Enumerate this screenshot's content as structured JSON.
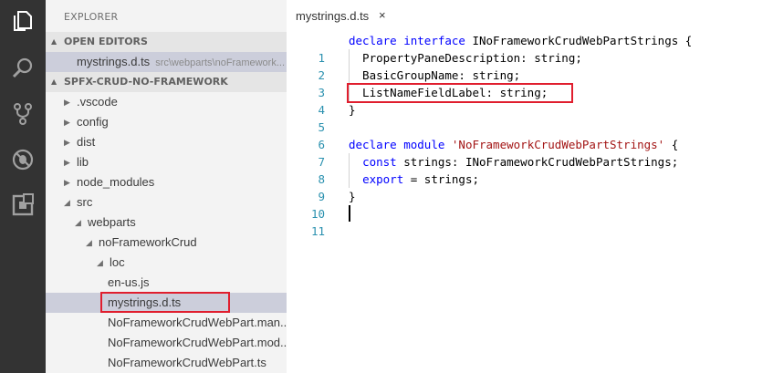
{
  "activity_bar": {
    "icons": [
      "files-icon",
      "search-icon",
      "source-control-icon",
      "debug-icon",
      "extensions-icon"
    ]
  },
  "sidebar": {
    "title": "EXPLORER",
    "open_editors": {
      "header": "OPEN EDITORS",
      "items": [
        {
          "name": "mystrings.d.ts",
          "path": "src\\webparts\\noFramework..."
        }
      ]
    },
    "project": {
      "header": "SPFX-CRUD-NO-FRAMEWORK",
      "tree": [
        {
          "label": ".vscode",
          "expanded": false
        },
        {
          "label": "config",
          "expanded": false
        },
        {
          "label": "dist",
          "expanded": false
        },
        {
          "label": "lib",
          "expanded": false
        },
        {
          "label": "node_modules",
          "expanded": false
        },
        {
          "label": "src",
          "expanded": true
        },
        {
          "label": "webparts",
          "expanded": true
        },
        {
          "label": "noFrameworkCrud",
          "expanded": true
        },
        {
          "label": "loc",
          "expanded": true
        },
        {
          "label": "en-us.js"
        },
        {
          "label": "mystrings.d.ts",
          "selected": true
        },
        {
          "label": "NoFrameworkCrudWebPart.man..."
        },
        {
          "label": "NoFrameworkCrudWebPart.mod..."
        },
        {
          "label": "NoFrameworkCrudWebPart.ts"
        }
      ]
    }
  },
  "editor": {
    "tab": {
      "label": "mystrings.d.ts",
      "close": "×"
    },
    "lines": [
      {
        "num": "1",
        "kw1": "declare",
        "kw2": "interface",
        "rest": "INoFrameworkCrudWebPartStrings {"
      },
      {
        "num": "2",
        "text": "  PropertyPaneDescription: string;"
      },
      {
        "num": "3",
        "text": "  BasicGroupName: string;"
      },
      {
        "num": "4",
        "text": "  ListNameFieldLabel: string;"
      },
      {
        "num": "5",
        "text": "}"
      },
      {
        "num": "6",
        "text": ""
      },
      {
        "num": "7",
        "kw1": "declare",
        "kw2": "module",
        "str": "'NoFrameworkCrudWebPartStrings'",
        "rest": " {"
      },
      {
        "num": "8",
        "kw": "const",
        "rest": " strings: INoFrameworkCrudWebPartStrings;"
      },
      {
        "num": "9",
        "kw": "export",
        "rest": " = strings;"
      },
      {
        "num": "10",
        "text": "}"
      },
      {
        "num": "11",
        "text": ""
      }
    ]
  },
  "colors": {
    "activity_bar": "#333333",
    "sidebar": "#f3f3f3",
    "highlight_box": "#e01e2e",
    "keyword": "#0000ff",
    "string": "#a31515",
    "line_number": "#2b91af"
  }
}
